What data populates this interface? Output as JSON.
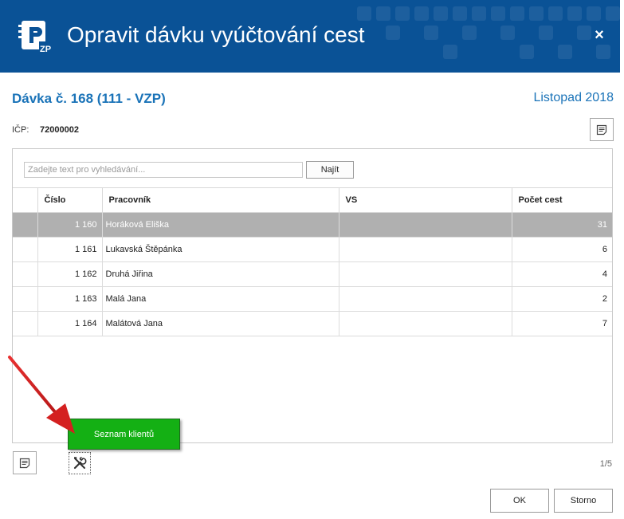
{
  "window": {
    "title": "Opravit dávku vyúčtování cest",
    "logo_text": "ZP",
    "close_symbol": "×"
  },
  "batch": {
    "title": "Dávka č. 168 (111 - VZP)",
    "period": "Listopad 2018"
  },
  "icp": {
    "label": "IČP:",
    "value": "72000002"
  },
  "search": {
    "placeholder": "Zadejte text pro vyhledávání...",
    "button_label": "Najít"
  },
  "table": {
    "columns": [
      "",
      "Číslo",
      "Pracovník",
      "VS",
      "Počet cest"
    ],
    "rows": [
      {
        "cislo": "1 160",
        "pracovnik": "Horáková Eliška",
        "vs": "",
        "pocet": "31",
        "selected": true
      },
      {
        "cislo": "1 161",
        "pracovnik": "Lukavská Štěpánka",
        "vs": "",
        "pocet": "6",
        "selected": false
      },
      {
        "cislo": "1 162",
        "pracovnik": "Druhá Jiřina",
        "vs": "",
        "pocet": "4",
        "selected": false
      },
      {
        "cislo": "1 163",
        "pracovnik": "Malá Jana",
        "vs": "",
        "pocet": "2",
        "selected": false
      },
      {
        "cislo": "1 164",
        "pracovnik": "Malátová Jana",
        "vs": "",
        "pocet": "7",
        "selected": false
      }
    ]
  },
  "tooltip": {
    "text": "Seznam klientů"
  },
  "pager": {
    "text": "1/5"
  },
  "footer": {
    "ok_label": "OK",
    "cancel_label": "Storno"
  },
  "icons": {
    "report_top": "report-icon",
    "report_bottom": "report-icon",
    "tools": "tools-icon",
    "close": "close-icon",
    "logo": "zp-logo-icon"
  },
  "colors": {
    "header_bg": "#0a5296",
    "accent_text": "#1a73b8",
    "selected_row": "#b0b0b0",
    "tooltip_bg": "#14b014",
    "arrow": "#d42020"
  }
}
